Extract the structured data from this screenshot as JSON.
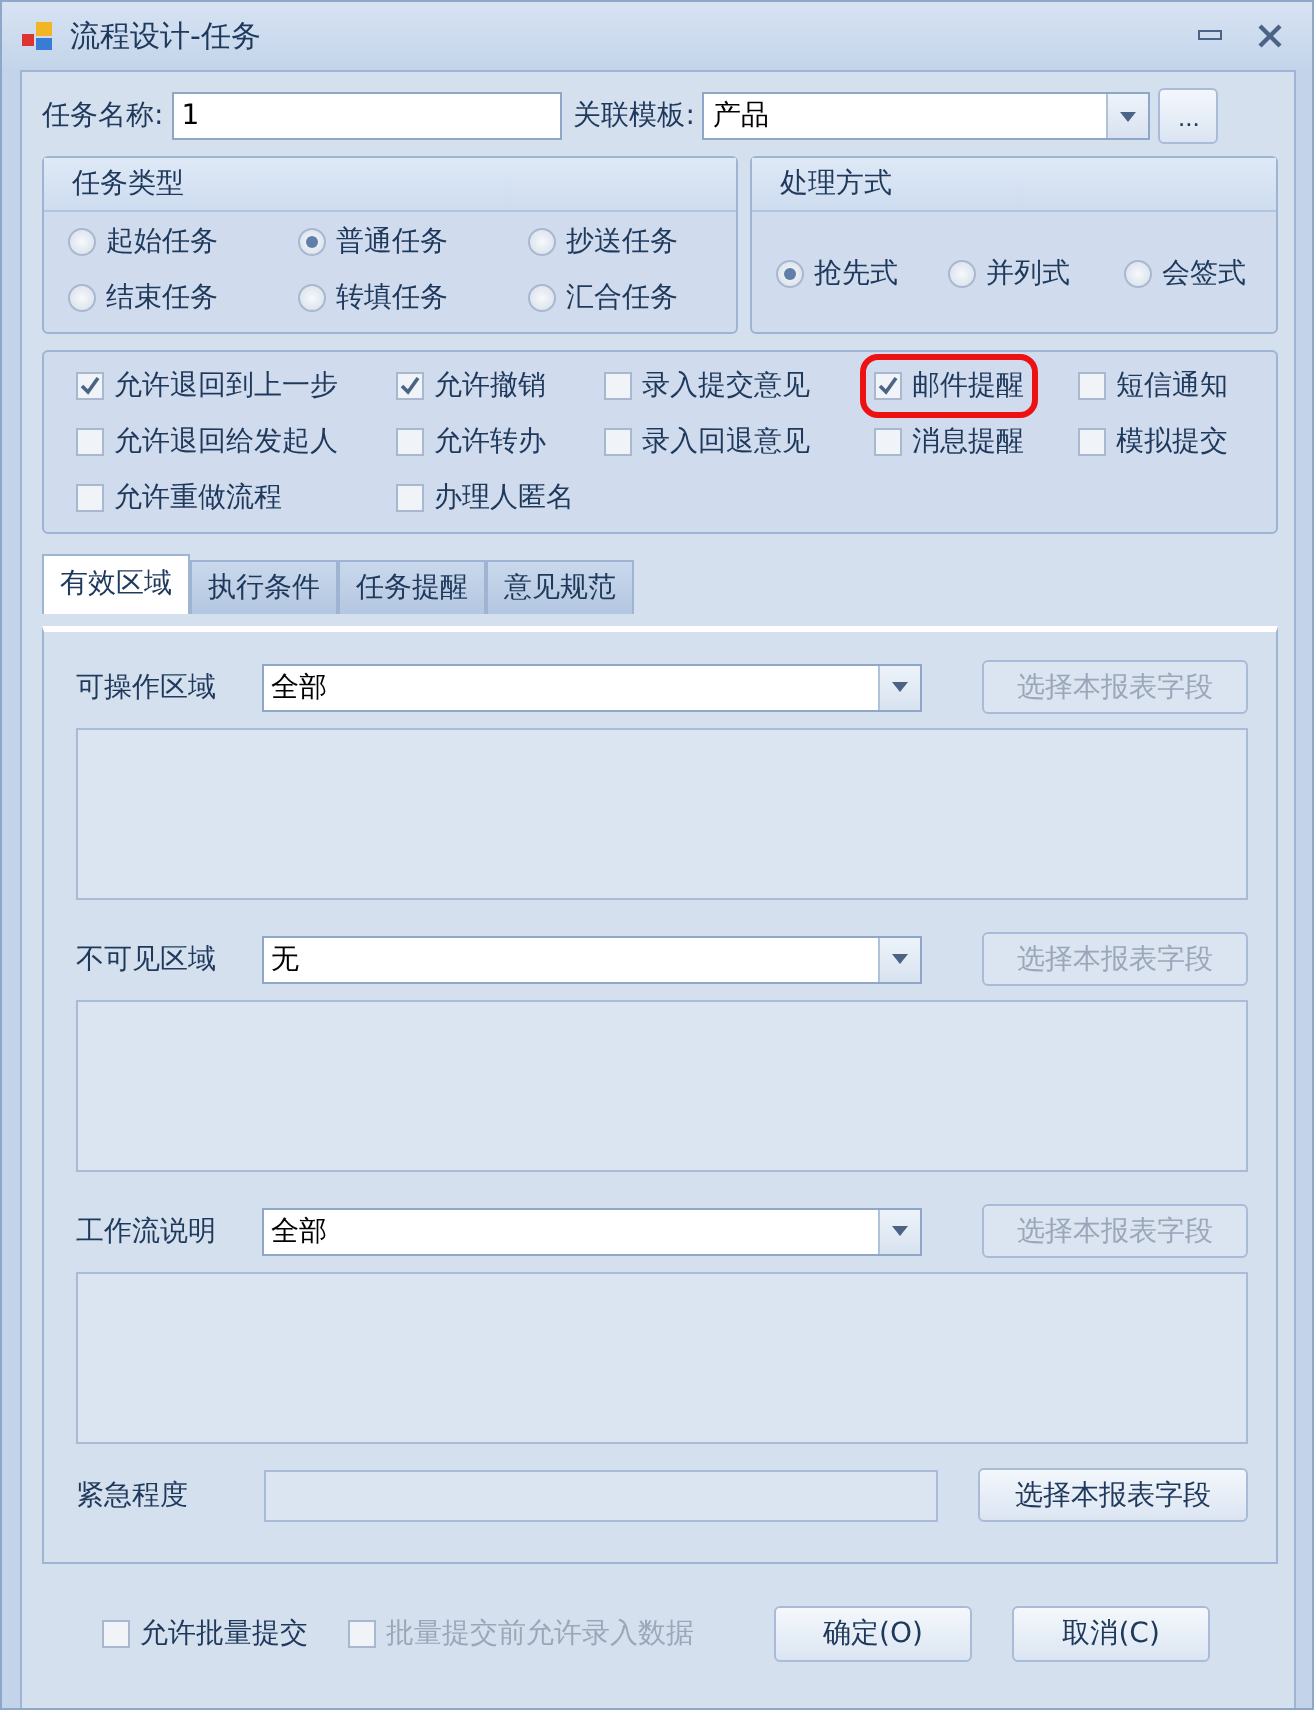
{
  "window": {
    "title": "流程设计-任务"
  },
  "task_name": {
    "label": "任务名称:",
    "value": "1"
  },
  "template": {
    "label": "关联模板:",
    "value": "产品",
    "more": "..."
  },
  "task_type": {
    "title": "任务类型",
    "options": [
      {
        "label": "起始任务",
        "selected": false
      },
      {
        "label": "普通任务",
        "selected": true
      },
      {
        "label": "抄送任务",
        "selected": false
      },
      {
        "label": "结束任务",
        "selected": false
      },
      {
        "label": "转填任务",
        "selected": false
      },
      {
        "label": "汇合任务",
        "selected": false
      }
    ]
  },
  "handling": {
    "title": "处理方式",
    "options": [
      {
        "label": "抢先式",
        "selected": true
      },
      {
        "label": "并列式",
        "selected": false
      },
      {
        "label": "会签式",
        "selected": false
      }
    ]
  },
  "options": [
    {
      "label": "允许退回到上一步",
      "checked": true,
      "highlighted": false
    },
    {
      "label": "允许撤销",
      "checked": true,
      "highlighted": false
    },
    {
      "label": "录入提交意见",
      "checked": false,
      "highlighted": false
    },
    {
      "label": "邮件提醒",
      "checked": true,
      "highlighted": true
    },
    {
      "label": "短信通知",
      "checked": false,
      "highlighted": false
    },
    {
      "label": "允许退回给发起人",
      "checked": false,
      "highlighted": false
    },
    {
      "label": "允许转办",
      "checked": false,
      "highlighted": false
    },
    {
      "label": "录入回退意见",
      "checked": false,
      "highlighted": false
    },
    {
      "label": "消息提醒",
      "checked": false,
      "highlighted": false
    },
    {
      "label": "模拟提交",
      "checked": false,
      "highlighted": false
    },
    {
      "label": "允许重做流程",
      "checked": false,
      "highlighted": false
    },
    {
      "label": "办理人匿名",
      "checked": false,
      "highlighted": false
    }
  ],
  "tabs": [
    {
      "label": "有效区域",
      "selected": true
    },
    {
      "label": "执行条件",
      "selected": false
    },
    {
      "label": "任务提醒",
      "selected": false
    },
    {
      "label": "意见规范",
      "selected": false
    }
  ],
  "regions": [
    {
      "label": "可操作区域",
      "value": "全部",
      "button": "选择本报表字段",
      "button_disabled": true
    },
    {
      "label": "不可见区域",
      "value": "无",
      "button": "选择本报表字段",
      "button_disabled": true
    },
    {
      "label": "工作流说明",
      "value": "全部",
      "button": "选择本报表字段",
      "button_disabled": true
    }
  ],
  "urgency": {
    "label": "紧急程度",
    "button": "选择本报表字段",
    "button_disabled": false
  },
  "footer_options": [
    {
      "label": "允许批量提交",
      "checked": false,
      "disabled": false
    },
    {
      "label": "批量提交前允许录入数据",
      "checked": false,
      "disabled": true
    }
  ],
  "buttons": [
    "确定(O)",
    "取消(C)"
  ]
}
